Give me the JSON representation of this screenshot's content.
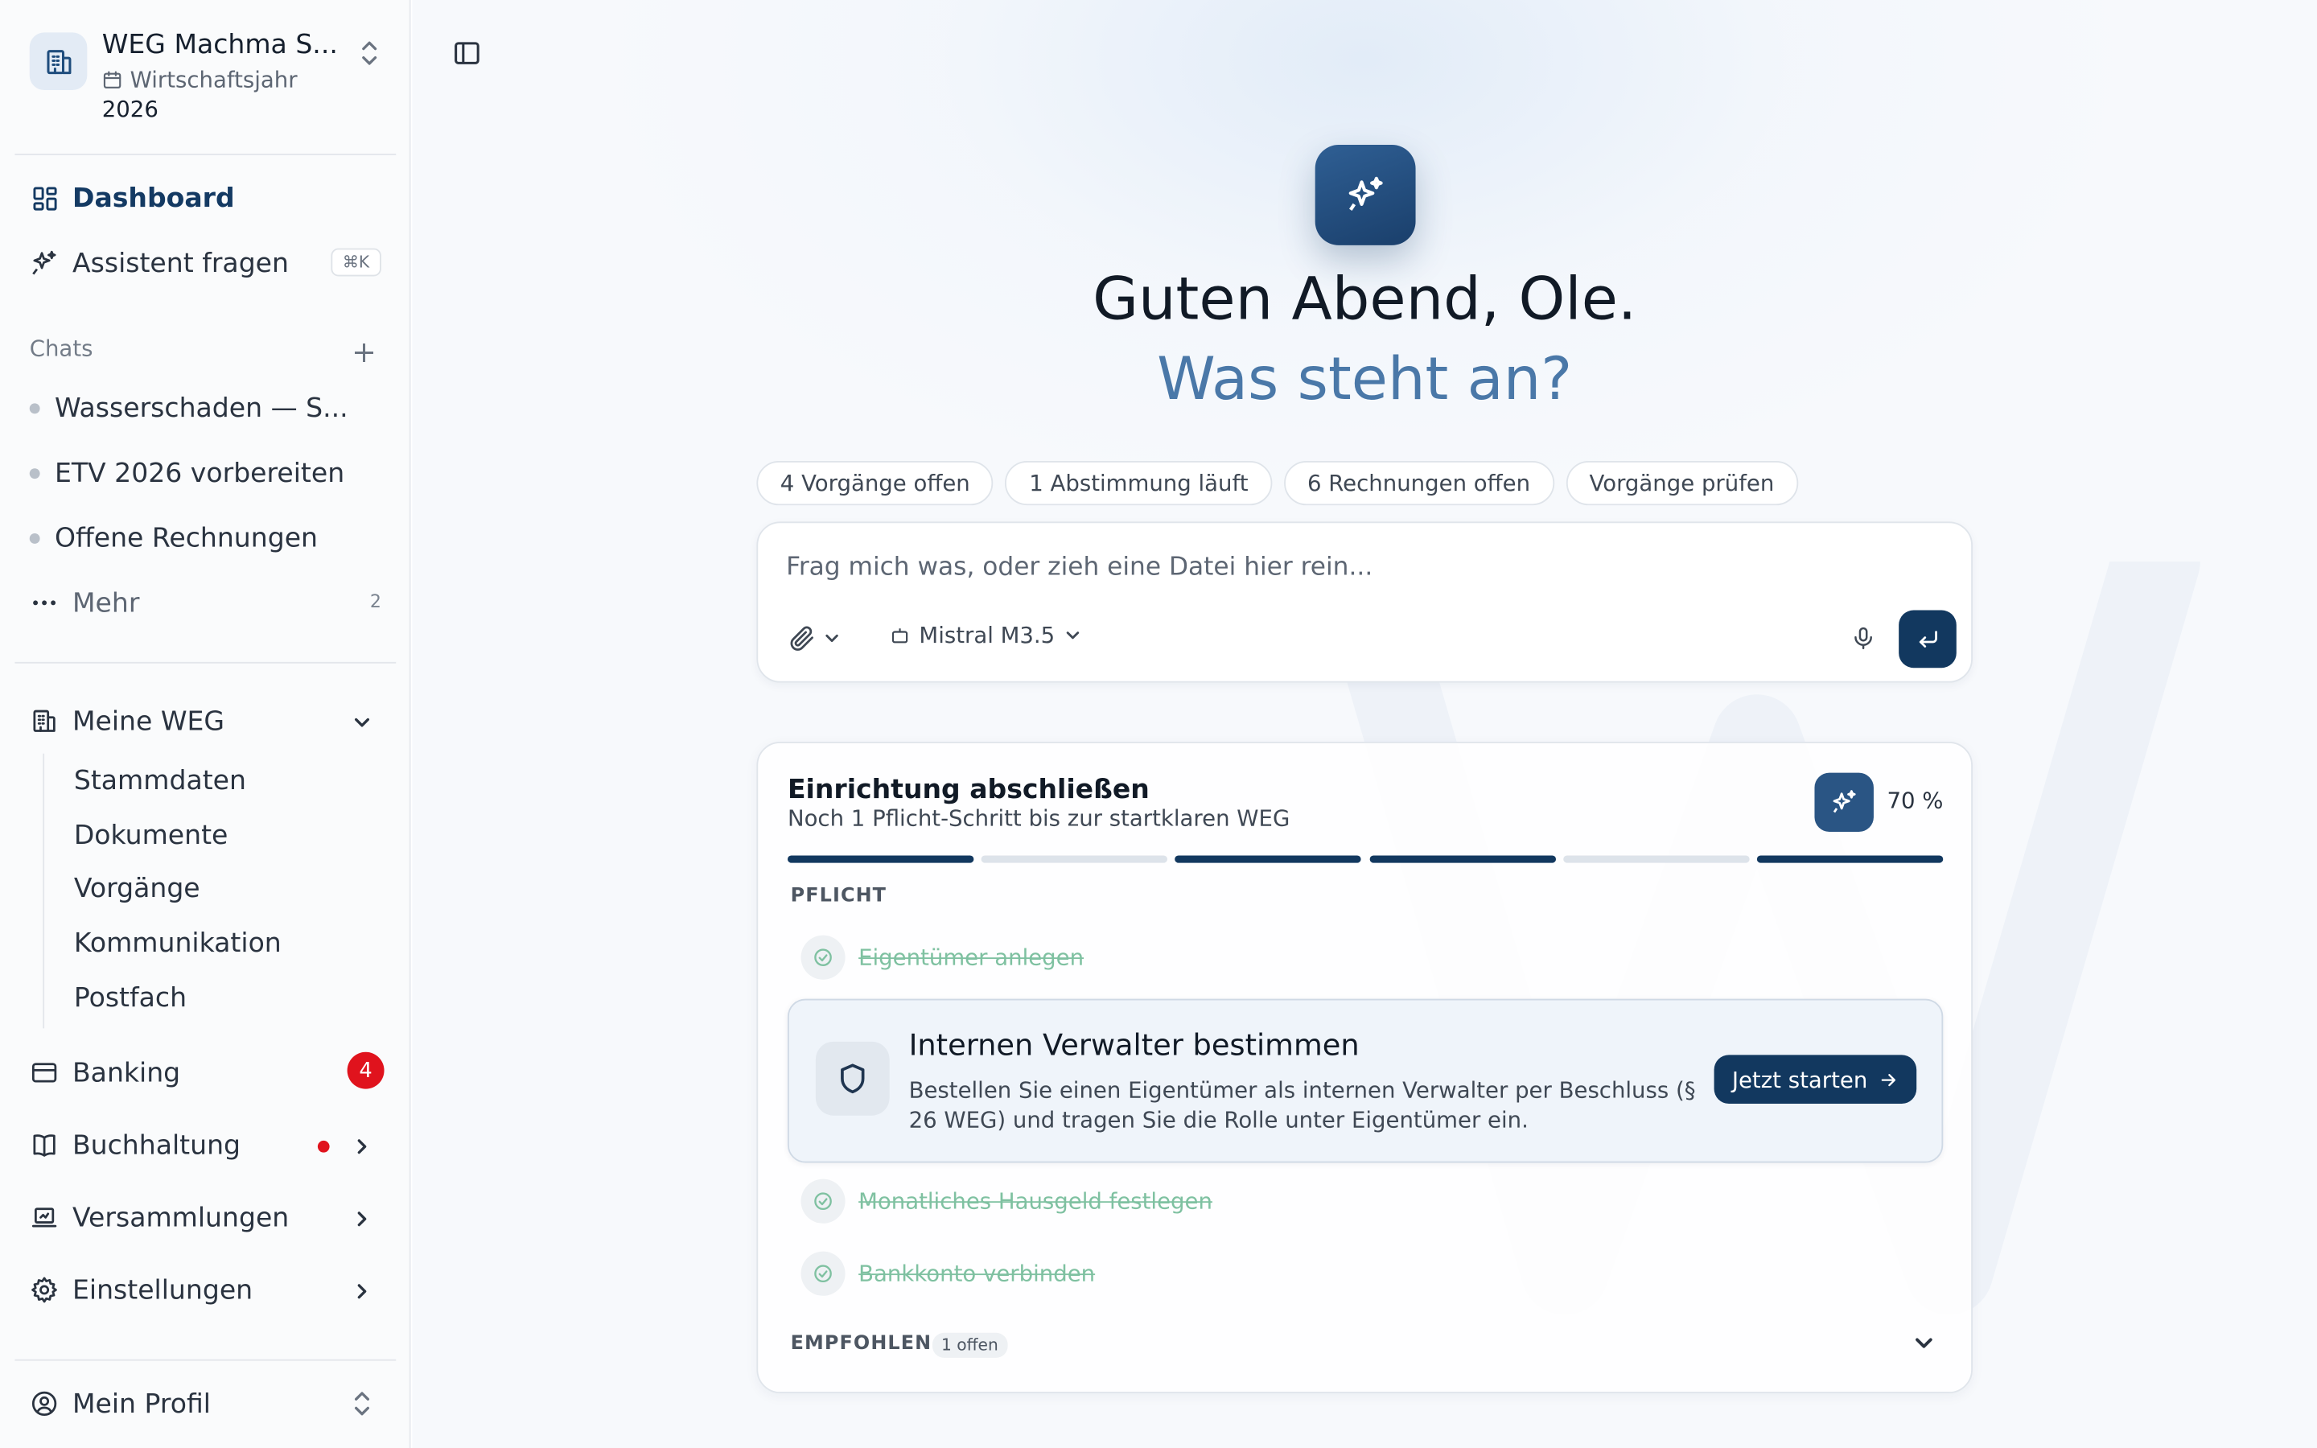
{
  "workspace": {
    "name": "WEG Machma S...",
    "subtitle": "Wirtschaftsjahr",
    "year": "2026",
    "logo_icon": "building-icon"
  },
  "nav": {
    "dashboard": "Dashboard",
    "assistant": "Assistent fragen",
    "assistant_shortcut": "⌘K"
  },
  "chats": {
    "label": "Chats",
    "items": [
      "Wasserschaden — S...",
      "ETV 2026 vorbereiten",
      "Offene Rechnungen"
    ],
    "more_label": "Mehr",
    "more_count": "2"
  },
  "weg": {
    "label": "Meine WEG",
    "items": [
      "Stammdaten",
      "Dokumente",
      "Vorgänge",
      "Kommunikation",
      "Postfach"
    ]
  },
  "sections": {
    "banking": "Banking",
    "banking_badge": "4",
    "buchhaltung": "Buchhaltung",
    "versammlungen": "Versammlungen",
    "einstellungen": "Einstellungen"
  },
  "profile": {
    "label": "Mein Profil"
  },
  "hero": {
    "greeting": "Guten Abend, Ole.",
    "question": "Was steht an?"
  },
  "chips": [
    "4 Vorgänge offen",
    "1 Abstimmung läuft",
    "6 Rechnungen offen",
    "Vorgänge prüfen"
  ],
  "composer": {
    "placeholder": "Frag mich was, oder zieh eine Datei hier rein...",
    "value": "",
    "model": "Mistral M3.5"
  },
  "setup": {
    "title": "Einrichtung abschließen",
    "subtitle": "Noch 1 Pflicht-Schritt bis zur startklaren WEG",
    "progress_label": "70 %",
    "progress": 0.7,
    "segments": [
      true,
      false,
      true,
      true,
      false,
      true
    ],
    "required_label": "PFLICHT",
    "done_steps": [
      "Eigentümer anlegen",
      "Monatliches Hausgeld festlegen",
      "Bankkonto verbinden"
    ],
    "active_task": {
      "title": "Internen Verwalter bestimmen",
      "description": "Bestellen Sie einen Eigentümer als internen Verwalter per Beschluss (§ 26 WEG) und tragen Sie die Rolle unter Eigentümer ein.",
      "button": "Jetzt starten"
    },
    "recommended_label": "EMPFOHLEN",
    "recommended_count": "1 offen"
  },
  "colors": {
    "primary": "#12385f",
    "accent_text": "#4a78a8",
    "badge_red": "#e0131d",
    "done_green": "#7fc1a1"
  }
}
